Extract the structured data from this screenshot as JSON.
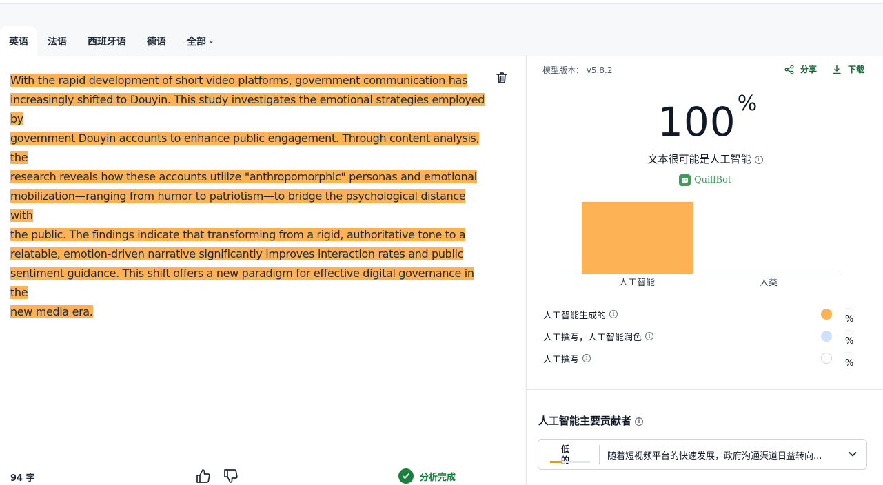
{
  "tabs": [
    {
      "label": "英语",
      "active": true
    },
    {
      "label": "法语",
      "active": false
    },
    {
      "label": "西班牙语",
      "active": false
    },
    {
      "label": "德语",
      "active": false
    },
    {
      "label": "全部",
      "active": false
    }
  ],
  "editor": {
    "lines": [
      "With the rapid development of short video platforms, government communication has",
      "increasingly shifted to Douyin. This study investigates the emotional strategies employed by",
      "government Douyin accounts to enhance public engagement. Through content analysis, the",
      "research reveals how these accounts utilize \"anthropomorphic\" personas and emotional",
      "mobilization—ranging from humor to patriotism—to bridge the psychological distance with",
      "the public. The findings indicate that transforming from a rigid, authoritative tone to a",
      "relatable, emotion-driven narrative significantly improves interaction rates and public",
      "sentiment guidance. This shift offers a new paradigm for effective digital governance in the",
      "new media era."
    ],
    "highlight_color": "#fdb256"
  },
  "footer": {
    "word_count": "94 字",
    "status": "分析完成",
    "status_color": "#16803c"
  },
  "report": {
    "version": "模型版本： v5.8.2",
    "share_label": "分享",
    "download_label": "下载",
    "score": "100",
    "score_unit": "%",
    "verdict": "文本很可能是人工智能",
    "brand": "QuillBot"
  },
  "chart_data": {
    "type": "bar",
    "categories": [
      "人工智能",
      "人类"
    ],
    "values": [
      100,
      0
    ],
    "ylim": [
      0,
      100
    ],
    "colors": [
      "#fdb256",
      "#fdb256"
    ]
  },
  "legend": [
    {
      "label": "人工智能生成的",
      "value": "-- %",
      "color": "#fdb256"
    },
    {
      "label": "人工撰写，人工智能润色",
      "value": "-- %",
      "color": "#cfe0fb"
    },
    {
      "label": "人工撰写",
      "value": "-- %",
      "color": "#ffffff"
    }
  ],
  "contributors": {
    "title": "人工智能主要贡献者",
    "items": [
      {
        "level": "低的",
        "level_fraction": 0.3,
        "text": "随着短视频平台的快速发展，政府沟通渠道日益转向..."
      }
    ]
  }
}
